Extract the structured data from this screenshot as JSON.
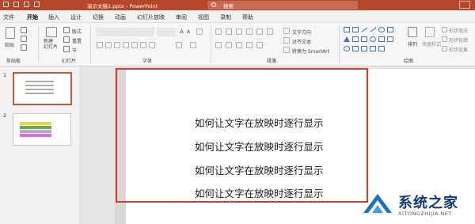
{
  "titlebar": {
    "document_title": "演示文稿1.pptx - PowerPoint",
    "search_label": "搜索"
  },
  "tabs": [
    "文件",
    "开始",
    "插入",
    "设计",
    "切换",
    "动画",
    "幻灯片放映",
    "审阅",
    "视图",
    "录制",
    "帮助"
  ],
  "active_tab": "开始",
  "ribbon": {
    "clipboard": {
      "paste_label": "粘贴",
      "group_label": "剪贴板"
    },
    "slides": {
      "new_slide_label": "新建\n幻灯片",
      "layout_label": "版式",
      "reset_label": "重置",
      "section_label": "节",
      "group_label": "幻灯片"
    },
    "font": {
      "group_label": "字体"
    },
    "paragraph": {
      "text_direction_label": "文字方向",
      "align_text_label": "对齐文本",
      "smartart_label": "转换为 SmartArt",
      "group_label": "段落"
    },
    "drawing": {
      "arrange_label": "排列",
      "quick_styles_label": "快速样式",
      "shape_fill_label": "形状填充",
      "shape_outline_label": "形状轮廓",
      "shape_effects_label": "形状效果",
      "group_label": "绘图"
    }
  },
  "slides_pane": {
    "slides": [
      {
        "number": "1",
        "selected": true
      },
      {
        "number": "2",
        "selected": false
      }
    ]
  },
  "slide": {
    "lines": [
      "如何让文字在放映时逐行显示",
      "如何让文字在放映时逐行显示",
      "如何让文字在放映时逐行显示",
      "如何让文字在放映时逐行显示"
    ]
  },
  "watermark": {
    "cn": "系统之家",
    "en": "XITONGZHIJIA.NET"
  },
  "colors": {
    "accent": "#b7472a",
    "highlight": "#e0352d"
  }
}
